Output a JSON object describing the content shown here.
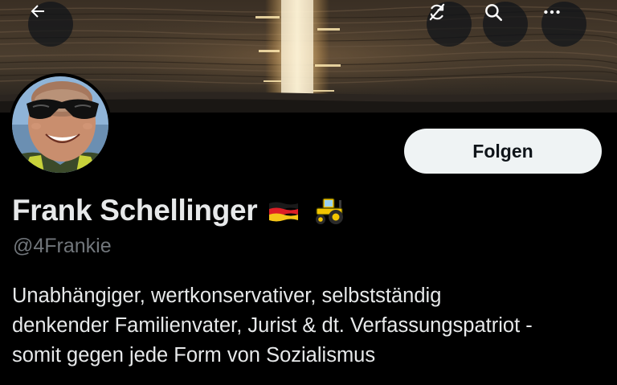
{
  "header": {
    "back_icon": "arrow-left-icon",
    "translate_icon": "refresh-slash-icon",
    "search_icon": "search-icon",
    "more_icon": "more-horizontal-icon"
  },
  "profile": {
    "display_name": "Frank Schellinger",
    "name_emojis": [
      "flag-germany-icon",
      "tractor-icon"
    ],
    "handle": "@4Frankie",
    "bio": "Unabhängiger, wertkonservativer, selbstständig\ndenkender Familienvater, Jurist & dt. Verfassungspatriot -\nsomit gegen jede Form von Sozialismus",
    "follow_label": "Folgen"
  },
  "colors": {
    "background": "#000000",
    "text_primary": "#e7e9ea",
    "text_secondary": "#71767b",
    "follow_button_bg": "#eff3f4",
    "follow_button_text": "#0f1419"
  }
}
